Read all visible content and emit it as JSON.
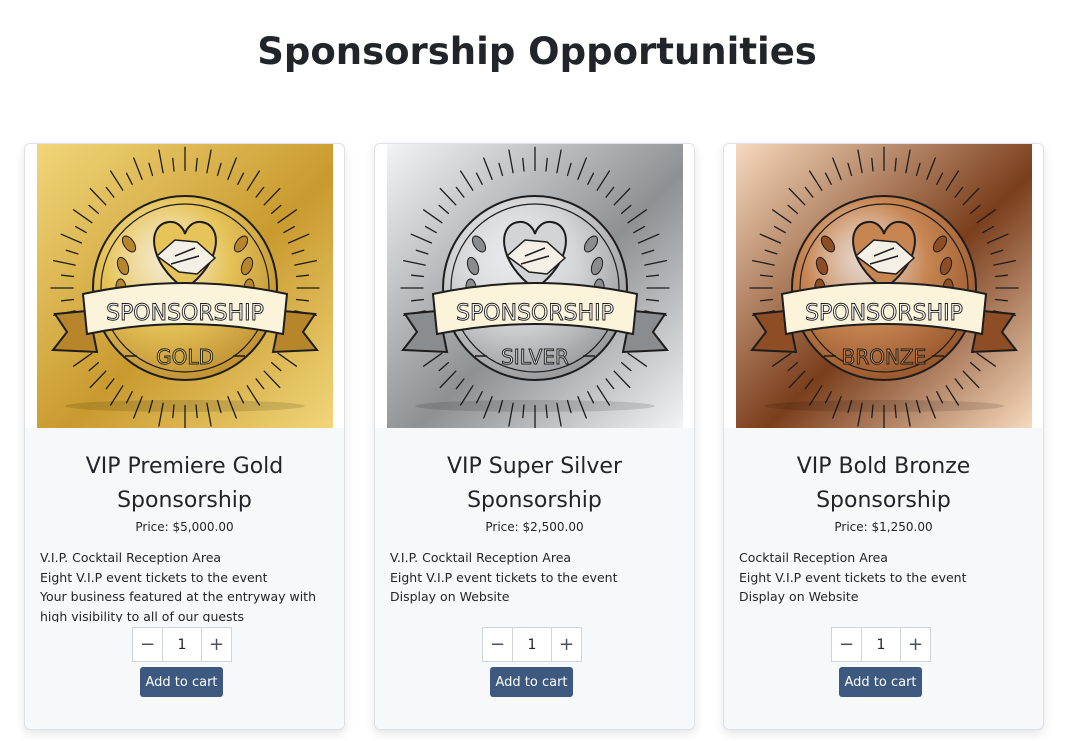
{
  "page": {
    "title": "Sponsorship Opportunities"
  },
  "cards": [
    {
      "title": "VIP Premiere Gold Sponsorship",
      "price": "Price: $5,000.00",
      "badge": {
        "top": "SPONSORSHIP",
        "bottom": "GOLD"
      },
      "colors": {
        "bg_light": "#f1d67a",
        "bg_dark": "#c99a2e",
        "medal": "#e6c45a",
        "medal_dark": "#b8862a"
      },
      "features": [
        "V.I.P. Cocktail Reception Area",
        "Eight V.I.P event tickets to the event",
        "Your business featured at the entryway with high visibility to all of our guests"
      ],
      "quantity": "1",
      "add_to_cart": "Add to cart"
    },
    {
      "title": "VIP Super Silver Sponsorship",
      "price": "Price: $2,500.00",
      "badge": {
        "top": "SPONSORSHIP",
        "bottom": "SILVER"
      },
      "colors": {
        "bg_light": "#f2f3f4",
        "bg_dark": "#8d9194",
        "medal": "#d2d4d6",
        "medal_dark": "#8a8d90"
      },
      "features": [
        "V.I.P. Cocktail Reception Area",
        "Eight V.I.P event tickets to the event",
        "Display on Website"
      ],
      "quantity": "1",
      "add_to_cart": "Add to cart"
    },
    {
      "title": "VIP Bold Bronze Sponsorship",
      "price": "Price: $1,250.00",
      "badge": {
        "top": "SPONSORSHIP",
        "bottom": "BRONZE"
      },
      "colors": {
        "bg_light": "#f6d9bd",
        "bg_dark": "#7a3e1c",
        "medal": "#c78552",
        "medal_dark": "#8e4d24"
      },
      "features": [
        "Cocktail Reception Area",
        "Eight V.I.P event tickets to the event",
        "Display on Website"
      ],
      "quantity": "1",
      "add_to_cart": "Add to cart"
    }
  ],
  "icons": {
    "minus": "minus-icon",
    "plus": "plus-icon"
  },
  "symbols": {
    "minus": "−",
    "plus": "+"
  }
}
